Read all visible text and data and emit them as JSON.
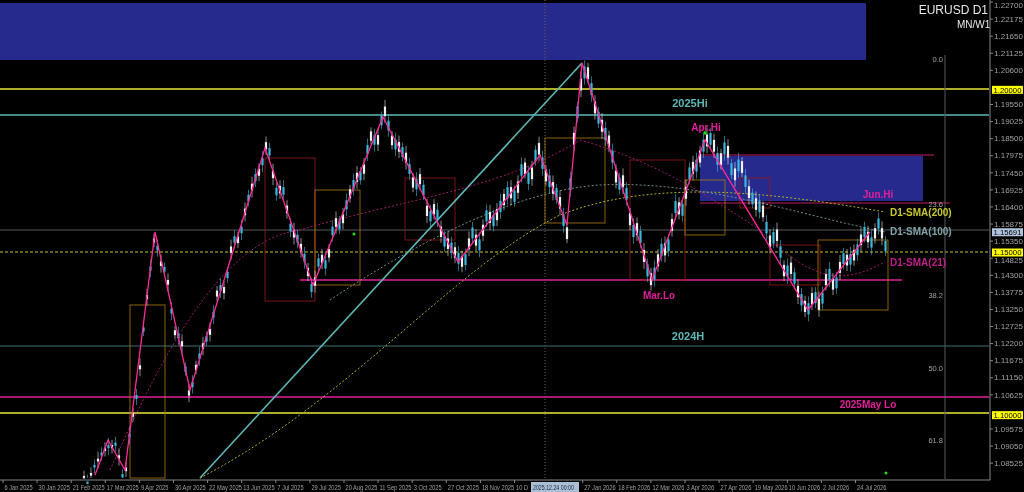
{
  "chart": {
    "title": "EURUSD D1",
    "timeframes": "MN/W1",
    "price_axis": [
      {
        "label": "1.22700",
        "kind": "tick"
      },
      {
        "label": "1.22175",
        "kind": "tick"
      },
      {
        "label": "1.21650",
        "kind": "tick"
      },
      {
        "label": "1.21125",
        "kind": "tick"
      },
      {
        "label": "1.20600",
        "kind": "tick"
      },
      {
        "label": "1.20000",
        "kind": "marker",
        "color": "#ffff00"
      },
      {
        "label": "1.19550",
        "kind": "tick"
      },
      {
        "label": "1.19025",
        "kind": "tick"
      },
      {
        "label": "1.18500",
        "kind": "tick"
      },
      {
        "label": "1.17975",
        "kind": "tick"
      },
      {
        "label": "1.17450",
        "kind": "tick"
      },
      {
        "label": "1.16925",
        "kind": "tick"
      },
      {
        "label": "1.16400",
        "kind": "tick"
      },
      {
        "label": "1.15875",
        "kind": "tick"
      },
      {
        "label": "1.15691",
        "kind": "marker",
        "color": "#b0c4de"
      },
      {
        "label": "1.15350",
        "kind": "tick"
      },
      {
        "label": "1.15000",
        "kind": "marker",
        "color": "#ffff00"
      },
      {
        "label": "1.14825",
        "kind": "tick"
      },
      {
        "label": "1.14300",
        "kind": "tick"
      },
      {
        "label": "1.13775",
        "kind": "tick"
      },
      {
        "label": "1.13250",
        "kind": "tick"
      },
      {
        "label": "1.12725",
        "kind": "tick"
      },
      {
        "label": "1.12200",
        "kind": "tick"
      },
      {
        "label": "1.11675",
        "kind": "tick"
      },
      {
        "label": "1.11150",
        "kind": "tick"
      },
      {
        "label": "1.10625",
        "kind": "tick"
      },
      {
        "label": "1.10000",
        "kind": "marker",
        "color": "#ffff00"
      },
      {
        "label": "1.09575",
        "kind": "tick"
      },
      {
        "label": "1.09050",
        "kind": "tick"
      },
      {
        "label": "1.08525",
        "kind": "tick"
      }
    ],
    "date_axis": [
      "6 Jan 2025",
      "30 Jan 2025",
      "21 Feb 2025",
      "17 Mar 2025",
      "9 Apr 2025",
      "30 Apr 2025",
      "22 May 2025",
      "13 Jun 2025",
      "7 Jul 2025",
      "29 Jul 2025",
      "20 Aug 2025",
      "11 Sep 2025",
      "3 Oct 2025",
      "27 Oct 2025",
      "18 Nov 2025",
      "10 D",
      "27 Jan 2026",
      "18 Feb 2026",
      "12 Mar 2026",
      "3 Apr 2026",
      "27 Apr 2026",
      "19 May 2026",
      "10 Jun 2026",
      "2 Jul 2026",
      "24 Jul 2026"
    ],
    "crosshair_label": "2025.12.24 00:00",
    "annotations": [
      {
        "text": "2025Hi",
        "color": "#5fb8b8"
      },
      {
        "text": "Apr.Hi",
        "color": "#e0209a"
      },
      {
        "text": "Jun.Hi",
        "color": "#e0209a"
      },
      {
        "text": "D1-SMA(200)",
        "color": "#c8c832"
      },
      {
        "text": "D1-SMA(100)",
        "color": "#7fa3a8"
      },
      {
        "text": "D1-SMA(21)",
        "color": "#c0208a"
      },
      {
        "text": "Mar.Lo",
        "color": "#e0209a"
      },
      {
        "text": "2024H",
        "color": "#5fb8b8"
      },
      {
        "text": "2025May Lo",
        "color": "#e0209a"
      }
    ],
    "fib_levels": [
      "0.0",
      "23.6",
      "38.2",
      "50.0",
      "61.8"
    ]
  }
}
